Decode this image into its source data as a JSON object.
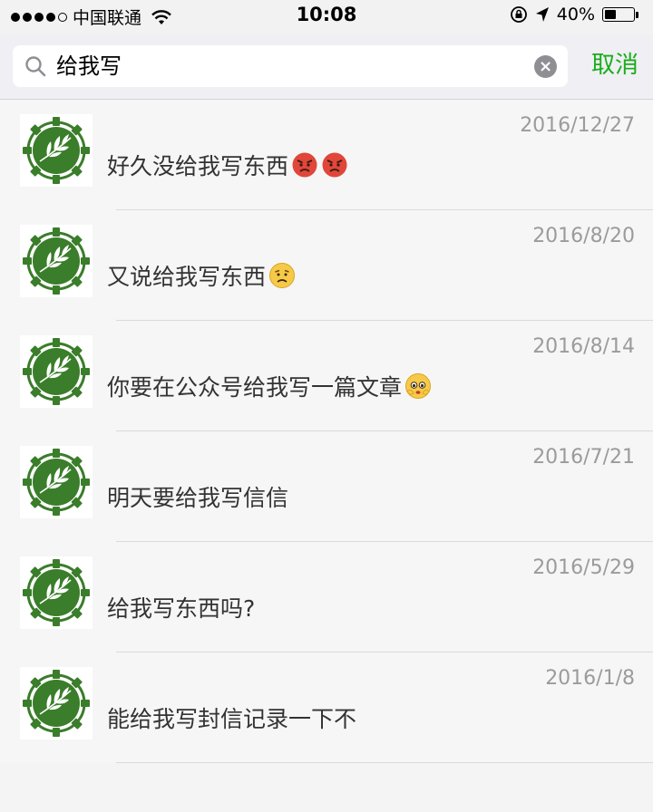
{
  "status_bar": {
    "carrier": "中国联通",
    "time": "10:08",
    "battery_percent": "40%",
    "battery_level": 0.4
  },
  "search": {
    "query": "给我写",
    "cancel_label": "取消"
  },
  "results": [
    {
      "date": "2016/12/27",
      "text": "好久没给我写东西",
      "emojis": [
        "angry-face-icon",
        "angry-face-icon"
      ]
    },
    {
      "date": "2016/8/20",
      "text": "又说给我写东西",
      "emojis": [
        "frowning-face-icon"
      ]
    },
    {
      "date": "2016/8/14",
      "text": "你要在公众号给我写一篇文章",
      "emojis": [
        "pleading-face-icon"
      ]
    },
    {
      "date": "2016/7/21",
      "text": "明天要给我写信信",
      "emojis": []
    },
    {
      "date": "2016/5/29",
      "text": "给我写东西吗?",
      "emojis": []
    },
    {
      "date": "2016/1/8",
      "text": "能给我写封信记录一下不",
      "emojis": []
    }
  ],
  "colors": {
    "accent_green": "#1aad19",
    "avatar_green": "#3a7d2a",
    "date_gray": "#9b9b9b"
  }
}
